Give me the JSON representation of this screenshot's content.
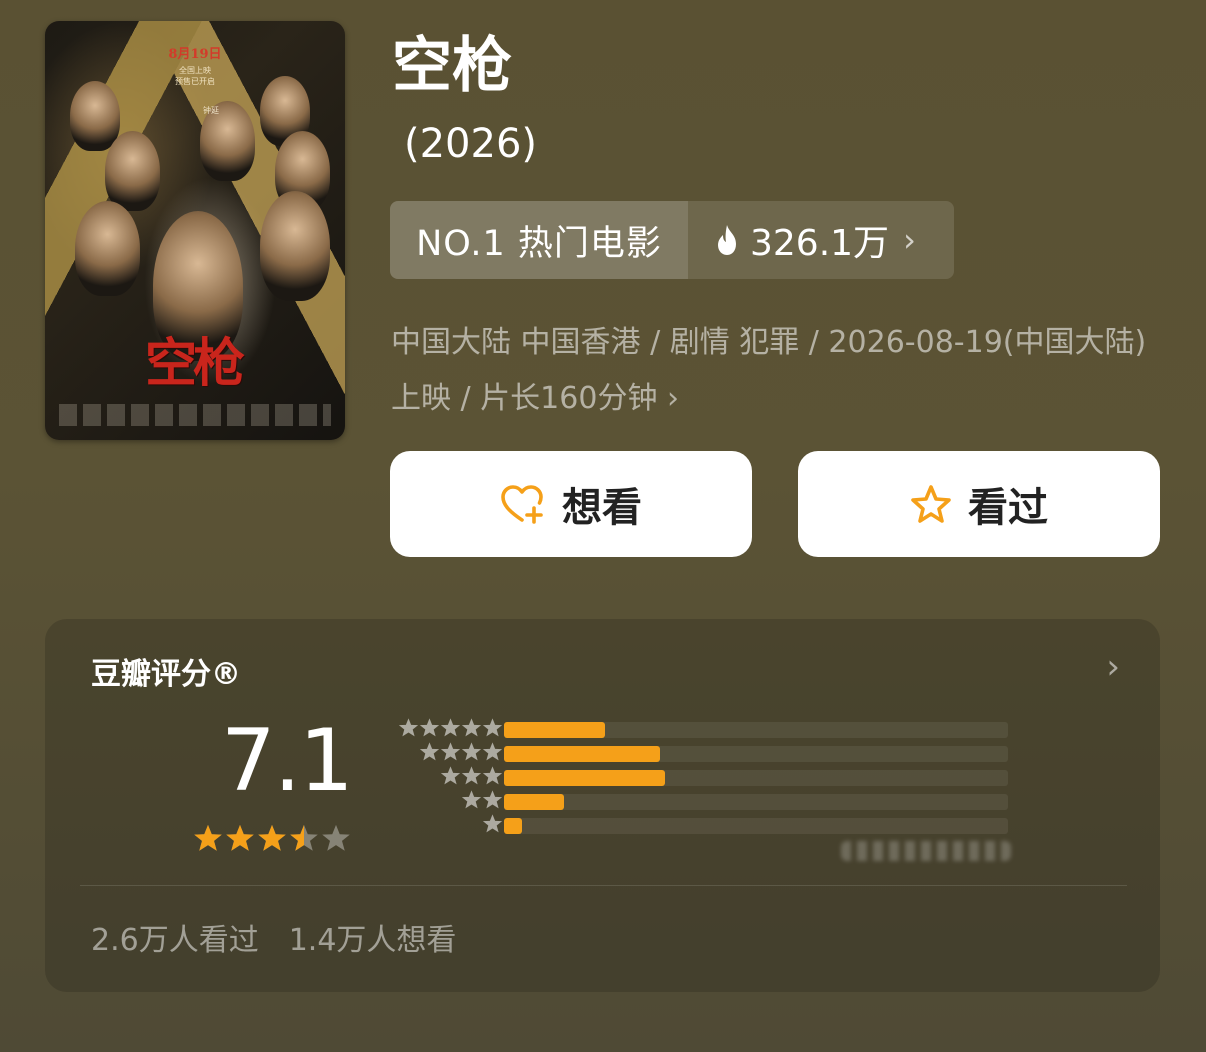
{
  "movie": {
    "title": "空枪",
    "year": "(2026)"
  },
  "poster": {
    "title_text": "空枪",
    "release_line1": "8月19日",
    "release_line2": "全国上映",
    "release_line3": "预售已开启",
    "credit_name": "钟延"
  },
  "rank": {
    "label": "NO.1 热门电影",
    "heat": "326.1万"
  },
  "meta": {
    "line": "中国大陆 中国香港 / 剧情 犯罪 / 2026-08-19(中国大陆) 上映 / 片长160分钟"
  },
  "actions": {
    "want_label": "想看",
    "seen_label": "看过"
  },
  "rating": {
    "label": "豆瓣评分®",
    "score": "7.1",
    "stars": 3.5,
    "distribution": [
      {
        "stars": 5,
        "fraction": 0.2
      },
      {
        "stars": 4,
        "fraction": 0.31
      },
      {
        "stars": 3,
        "fraction": 0.32
      },
      {
        "stars": 2,
        "fraction": 0.12
      },
      {
        "stars": 1,
        "fraction": 0.035
      }
    ],
    "seen_count": "2.6万人看过",
    "want_count": "1.4万人想看"
  },
  "colors": {
    "accent": "#f5a019",
    "background": "#5a5133"
  }
}
